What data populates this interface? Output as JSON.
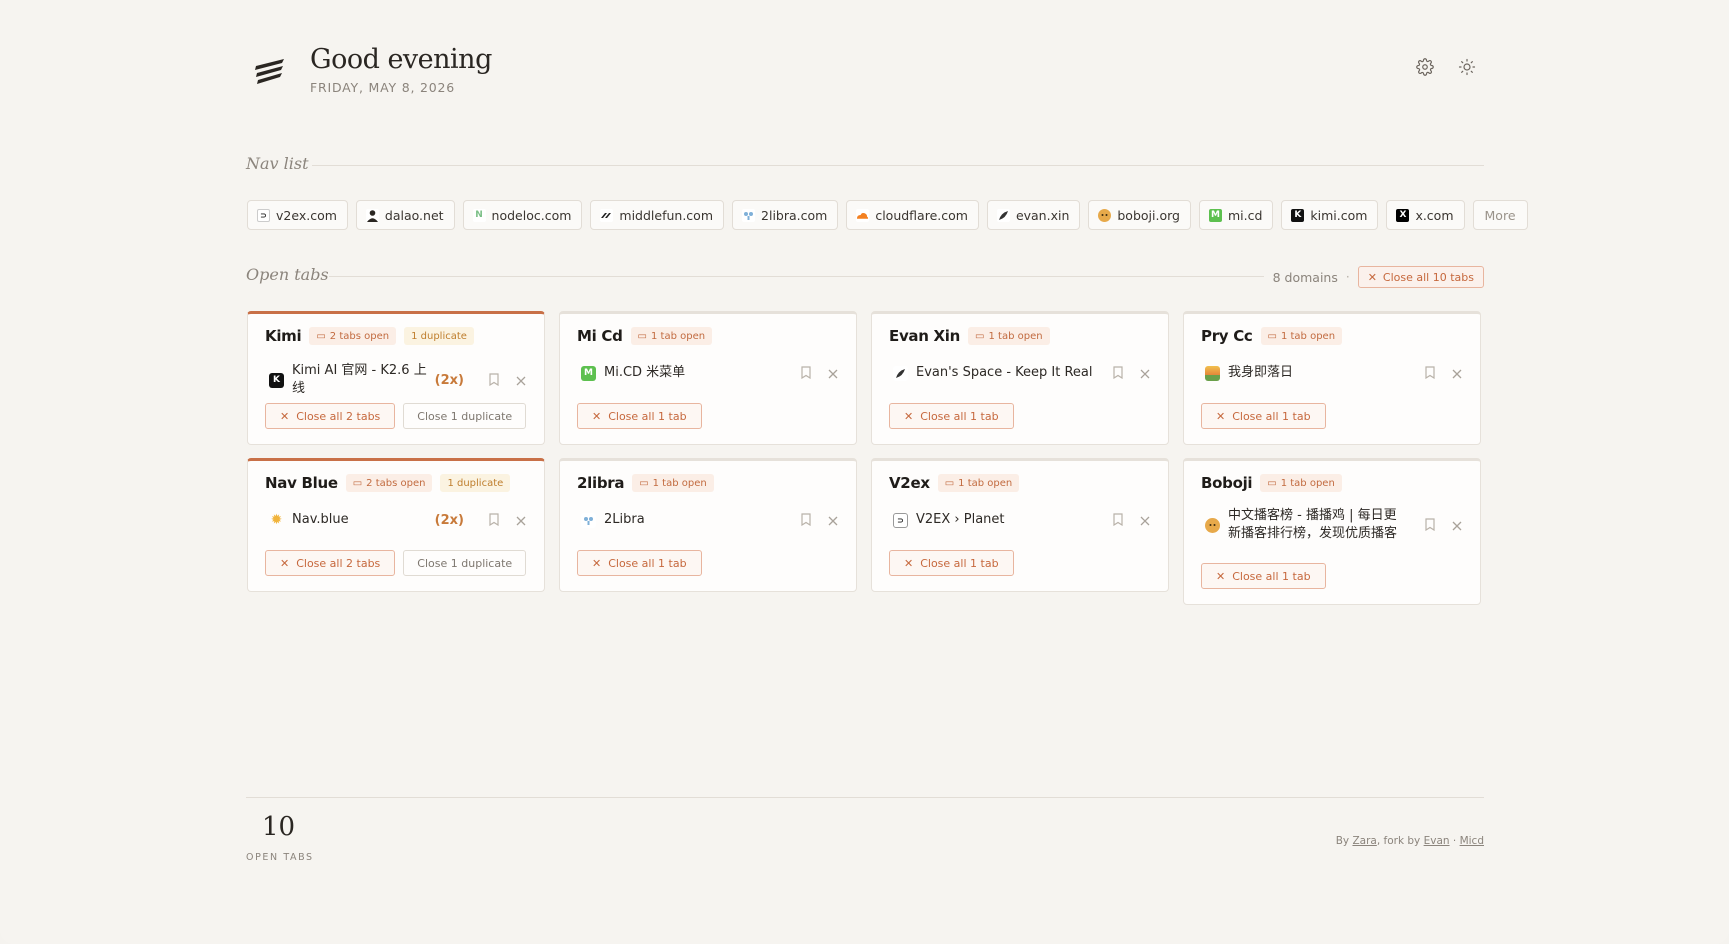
{
  "header": {
    "greeting": "Good evening",
    "date": "FRIDAY, MAY 8, 2026"
  },
  "nav": {
    "title": "Nav list",
    "items": [
      {
        "label": "v2ex.com",
        "icon": "v2ex-icon",
        "color": "#ffffff"
      },
      {
        "label": "dalao.net",
        "icon": "dalao-icon",
        "color": "#3a3530"
      },
      {
        "label": "nodeloc.com",
        "icon": "nodeloc-icon",
        "color": "#8fcf9a"
      },
      {
        "label": "middlefun.com",
        "icon": "middlefun-icon",
        "color": "#222222"
      },
      {
        "label": "2libra.com",
        "icon": "2libra-icon",
        "color": "#7fb0d8"
      },
      {
        "label": "cloudflare.com",
        "icon": "cloudflare-icon",
        "color": "#f38020"
      },
      {
        "label": "evan.xin",
        "icon": "evan-icon",
        "color": "#333333"
      },
      {
        "label": "boboji.org",
        "icon": "boboji-icon",
        "color": "#e7a94a"
      },
      {
        "label": "mi.cd",
        "icon": "micd-icon",
        "color": "#5dc04f"
      },
      {
        "label": "kimi.com",
        "icon": "kimi-icon",
        "color": "#111111"
      },
      {
        "label": "x.com",
        "icon": "x-icon",
        "color": "#000000"
      }
    ],
    "more": "More"
  },
  "open_tabs": {
    "title": "Open tabs",
    "domains_count": "8 domains",
    "sep": "·",
    "close_all": "Close all 10 tabs"
  },
  "cards": [
    {
      "title": "Kimi",
      "badge": "2 tabs open",
      "dup": "1 duplicate",
      "accent": true,
      "tab": "Kimi AI 官网 - K2.6 上线",
      "count": "(2x)",
      "icon": "kimi-favicon",
      "fav_color": "#111111",
      "fav_text": "K",
      "close": "Close all 2 tabs",
      "close_dup": "Close 1 duplicate"
    },
    {
      "title": "Mi Cd",
      "badge": "1 tab open",
      "tab": "Mi.CD 米菜单",
      "icon": "micd-favicon",
      "fav_color": "#5dc04f",
      "fav_text": "M",
      "close": "Close all 1 tab"
    },
    {
      "title": "Evan Xin",
      "badge": "1 tab open",
      "tab": "Evan's Space - Keep It Real",
      "icon": "evan-favicon",
      "fav_color": "#ffffff",
      "fav_text": "",
      "close": "Close all 1 tab"
    },
    {
      "title": "Pry Cc",
      "badge": "1 tab open",
      "tab": "我身即落日",
      "icon": "prycc-favicon",
      "fav_color": "#e4a63a",
      "fav_text": "",
      "close": "Close all 1 tab"
    },
    {
      "title": "Nav Blue",
      "badge": "2 tabs open",
      "dup": "1 duplicate",
      "accent": true,
      "tab": "Nav.blue",
      "count": "(2x)",
      "icon": "navblue-favicon",
      "fav_color": "#f1b43c",
      "fav_text": "",
      "close": "Close all 2 tabs",
      "close_dup": "Close 1 duplicate"
    },
    {
      "title": "2libra",
      "badge": "1 tab open",
      "tab": "2Libra",
      "icon": "2libra-favicon",
      "fav_color": "#7fb0d8",
      "fav_text": "",
      "close": "Close all 1 tab"
    },
    {
      "title": "V2ex",
      "badge": "1 tab open",
      "tab": "V2EX › Planet",
      "icon": "v2ex-favicon",
      "fav_color": "#ffffff",
      "fav_text": "",
      "close": "Close all 1 tab"
    },
    {
      "title": "Boboji",
      "badge": "1 tab open",
      "tab": "中文播客榜 - 播播鸡 | 每日更新播客排行榜，发现优质播客",
      "icon": "boboji-favicon",
      "fav_color": "#e7a94a",
      "fav_text": "",
      "close": "Close all 1 tab"
    }
  ],
  "footer": {
    "total": "10",
    "total_label": "OPEN TABS",
    "by": "By",
    "author": "Zara",
    "fork_by": ", fork by",
    "forker": "Evan",
    "sep": "·",
    "micd": "Micd"
  },
  "colors": {
    "accent": "#c87047",
    "background": "#f6f4f0"
  }
}
